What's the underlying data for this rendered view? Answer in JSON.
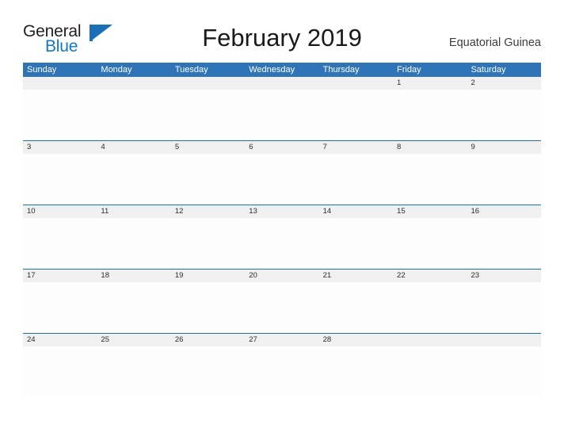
{
  "brand": {
    "name_part1": "General",
    "name_part2": "Blue",
    "flag_icon": "blue-flag-icon",
    "color_dark": "#231f20",
    "color_blue": "#1277c4"
  },
  "header": {
    "title": "February 2019",
    "country": "Equatorial Guinea"
  },
  "calendar": {
    "accent_color": "#3074b8",
    "rule_color": "#2170b0",
    "band_color": "#f0f0f0",
    "cell_color": "#fdfdfd",
    "weekdays": [
      "Sunday",
      "Monday",
      "Tuesday",
      "Wednesday",
      "Thursday",
      "Friday",
      "Saturday"
    ],
    "weeks": [
      {
        "days": [
          "",
          "",
          "",
          "",
          "",
          "1",
          "2"
        ]
      },
      {
        "days": [
          "3",
          "4",
          "5",
          "6",
          "7",
          "8",
          "9"
        ]
      },
      {
        "days": [
          "10",
          "11",
          "12",
          "13",
          "14",
          "15",
          "16"
        ]
      },
      {
        "days": [
          "17",
          "18",
          "19",
          "20",
          "21",
          "22",
          "23"
        ]
      },
      {
        "days": [
          "24",
          "25",
          "26",
          "27",
          "28",
          "",
          ""
        ]
      }
    ]
  }
}
